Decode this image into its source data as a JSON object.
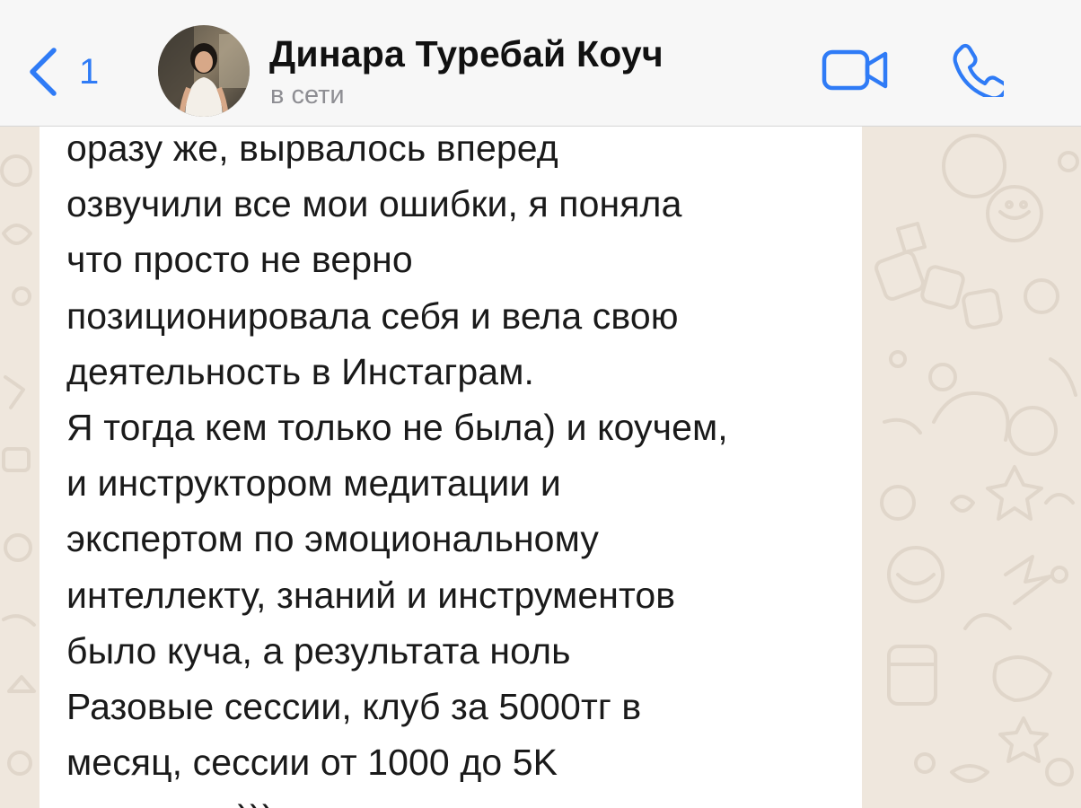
{
  "header": {
    "back_count": "1",
    "contact_name": "Динара Туребай Коуч",
    "status": "в сети",
    "accent_color": "#2f7bf6"
  },
  "icons": {
    "back": "chevron-left-icon",
    "video": "video-camera-icon",
    "call": "phone-icon"
  },
  "message": {
    "text": "оразу же, вырвалось вперед\nозвучили все мои ошибки, я поняла\nчто просто не верно\nпозиционировала себя и вела свою\nдеятельность в Инстаграм.\nЯ тогда кем только не была) и коучем,\nи инструктором медитации и\nэкспертом по эмоциональному\nинтеллекту, знаний и инструментов\nбыло куча, а результата ноль\nРазовые сессии, клуб за 5000тг в\nмесяц, сессии от 1000 до 5K\nмаксимум)))",
    "bubble_color": "#ffffff"
  },
  "wallpaper": {
    "background_color": "#efe7dd",
    "doodle_color": "#e2d9cd"
  }
}
